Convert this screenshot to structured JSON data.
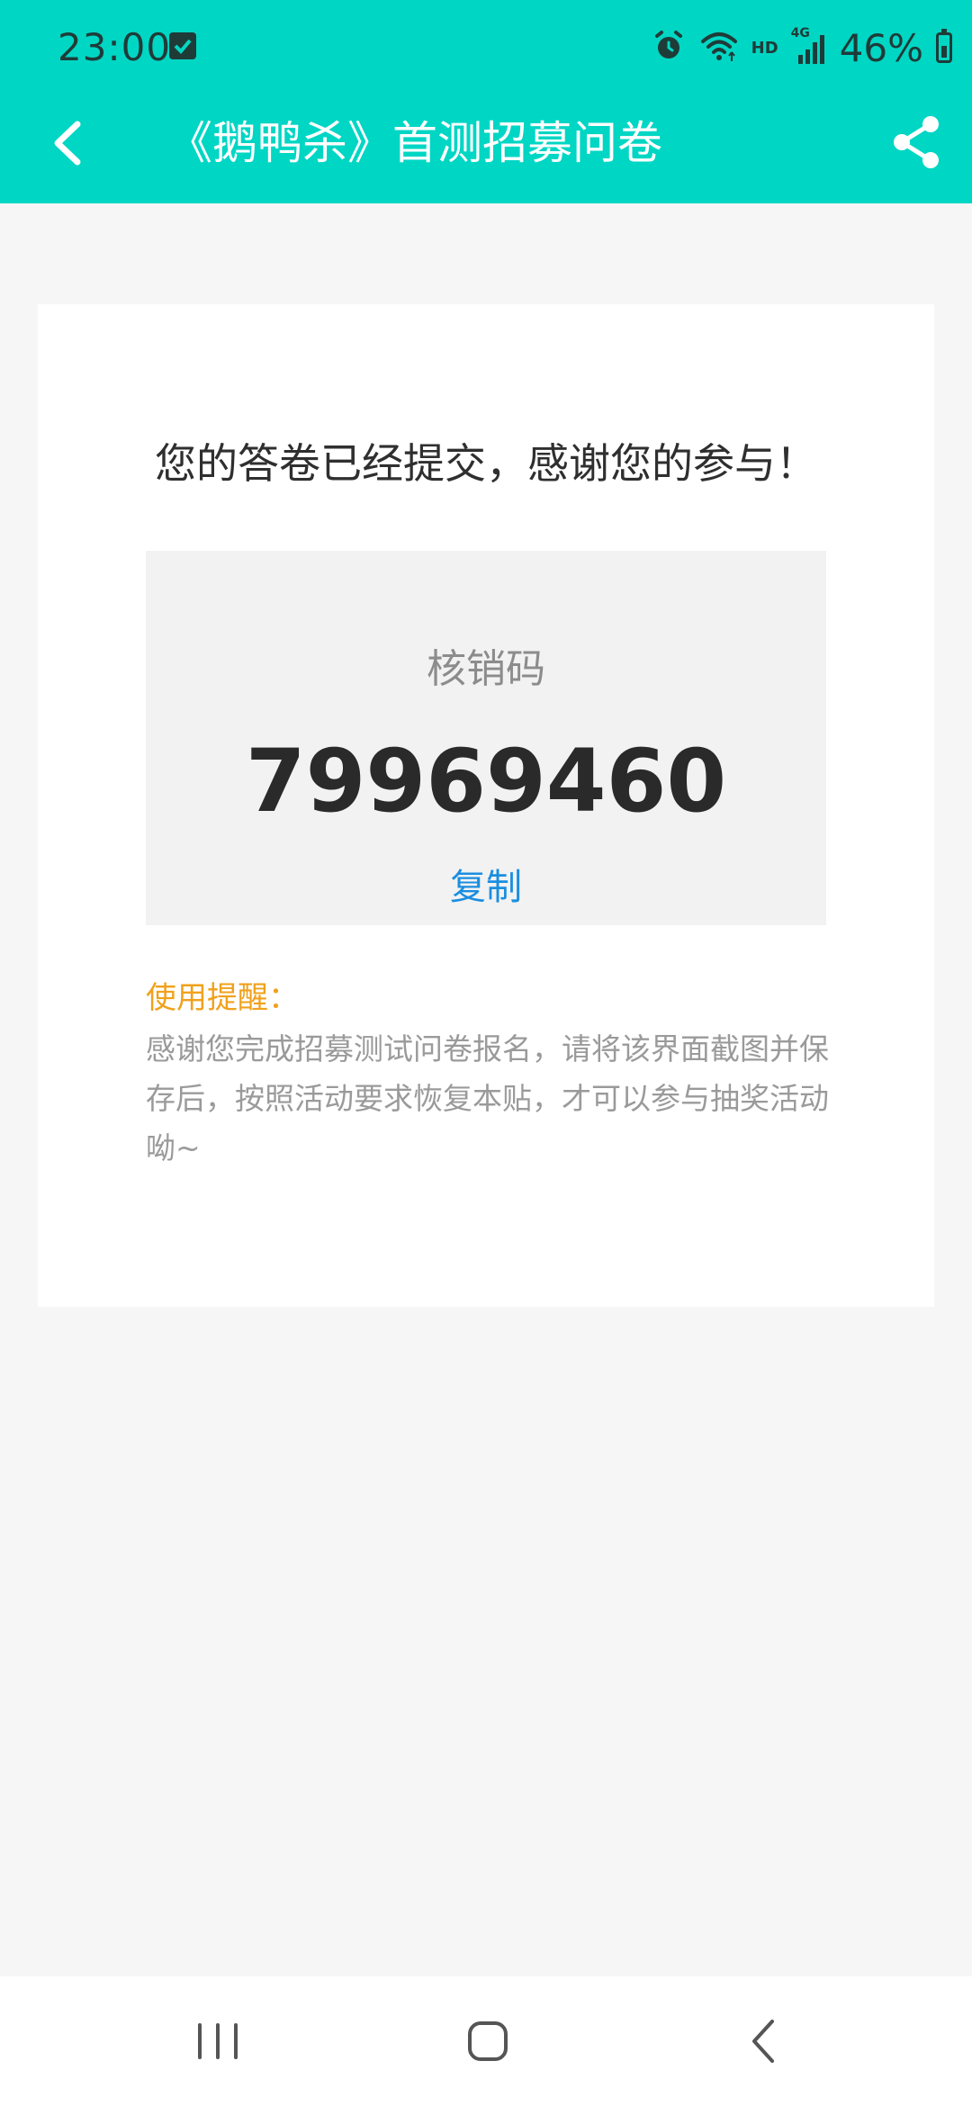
{
  "status_bar": {
    "time": "23:00",
    "hd_label": "HD",
    "network_label": "4G",
    "battery": "46%"
  },
  "header": {
    "title": "《鹅鸭杀》首测招募问卷",
    "icons": [
      "back-arrow-icon",
      "share-icon"
    ]
  },
  "result": {
    "thanks_message": "您的答卷已经提交，感谢您的参与！",
    "code_label": "核销码",
    "code_value": "79969460",
    "copy_label": "复制",
    "reminder_title": "使用提醒：",
    "reminder_text": "感谢您完成招募测试问卷报名，请将该界面截图并保存后，按照活动要求恢复本贴，才可以参与抽奖活动呦~"
  },
  "system_nav": {
    "icons": [
      "recent-apps-icon",
      "home-icon",
      "back-icon"
    ]
  },
  "colors": {
    "header_bg": "#00d6c4",
    "page_bg": "#f6f6f6",
    "code_box_bg": "#f2f2f2",
    "copy_link": "#1a8ee0",
    "reminder_title": "#f0a11c",
    "reminder_text": "#9a9a9a"
  }
}
